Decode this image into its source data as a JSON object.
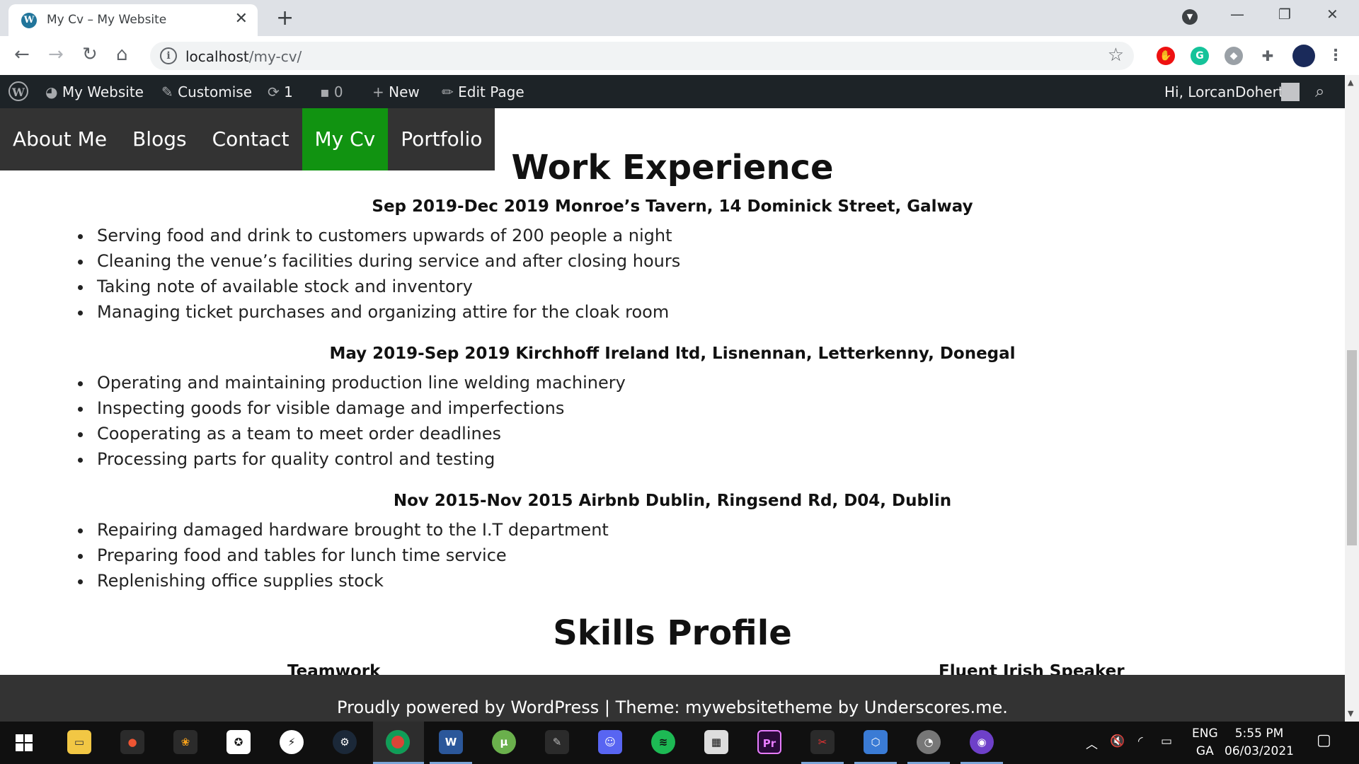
{
  "browser": {
    "tab_title": "My Cv – My Website",
    "url_host": "localhost",
    "url_path": "/my-cv/"
  },
  "admin_bar": {
    "site_name": "My Website",
    "customise": "Customise",
    "updates_count": "1",
    "comments_count": "0",
    "new_label": "New",
    "edit_page": "Edit Page",
    "greeting": "Hi, LorcanDoherty"
  },
  "nav": {
    "items": [
      "About Me",
      "Blogs",
      "Contact",
      "My Cv",
      "Portfolio"
    ],
    "active": "My Cv",
    "active_color": "#119311"
  },
  "work": {
    "heading": "Work Experience",
    "jobs": [
      {
        "title": "Sep 2019-Dec 2019 Monroe’s Tavern, 14 Dominick Street, Galway",
        "duties": [
          "Serving food and drink to customers upwards of 200 people a night",
          "Cleaning the venue’s facilities during service and after closing hours",
          "Taking note of available stock and inventory",
          "Managing ticket purchases and organizing attire for the cloak room"
        ]
      },
      {
        "title": "May 2019-Sep 2019 Kirchhoff Ireland ltd, Lisnennan, Letterkenny, Donegal",
        "duties": [
          "Operating and maintaining production line welding machinery",
          "Inspecting goods for visible damage and imperfections",
          "Cooperating as a team to meet order deadlines",
          "Processing parts for quality control and testing"
        ]
      },
      {
        "title": "Nov 2015-Nov 2015 Airbnb Dublin, Ringsend Rd, D04, Dublin",
        "duties": [
          "Repairing damaged hardware brought to the I.T department",
          "Preparing food and tables for lunch time service",
          "Replenishing office supplies stock"
        ]
      }
    ]
  },
  "skills": {
    "heading": "Skills Profile",
    "left": "Teamwork",
    "right": "Fluent Irish Speaker"
  },
  "footer": {
    "text": "Proudly powered by WordPress | Theme: mywebsitetheme by Underscores.me."
  },
  "taskbar": {
    "language": "ENG",
    "region": "GA",
    "time": "5:55 PM",
    "date": "06/03/2021"
  }
}
